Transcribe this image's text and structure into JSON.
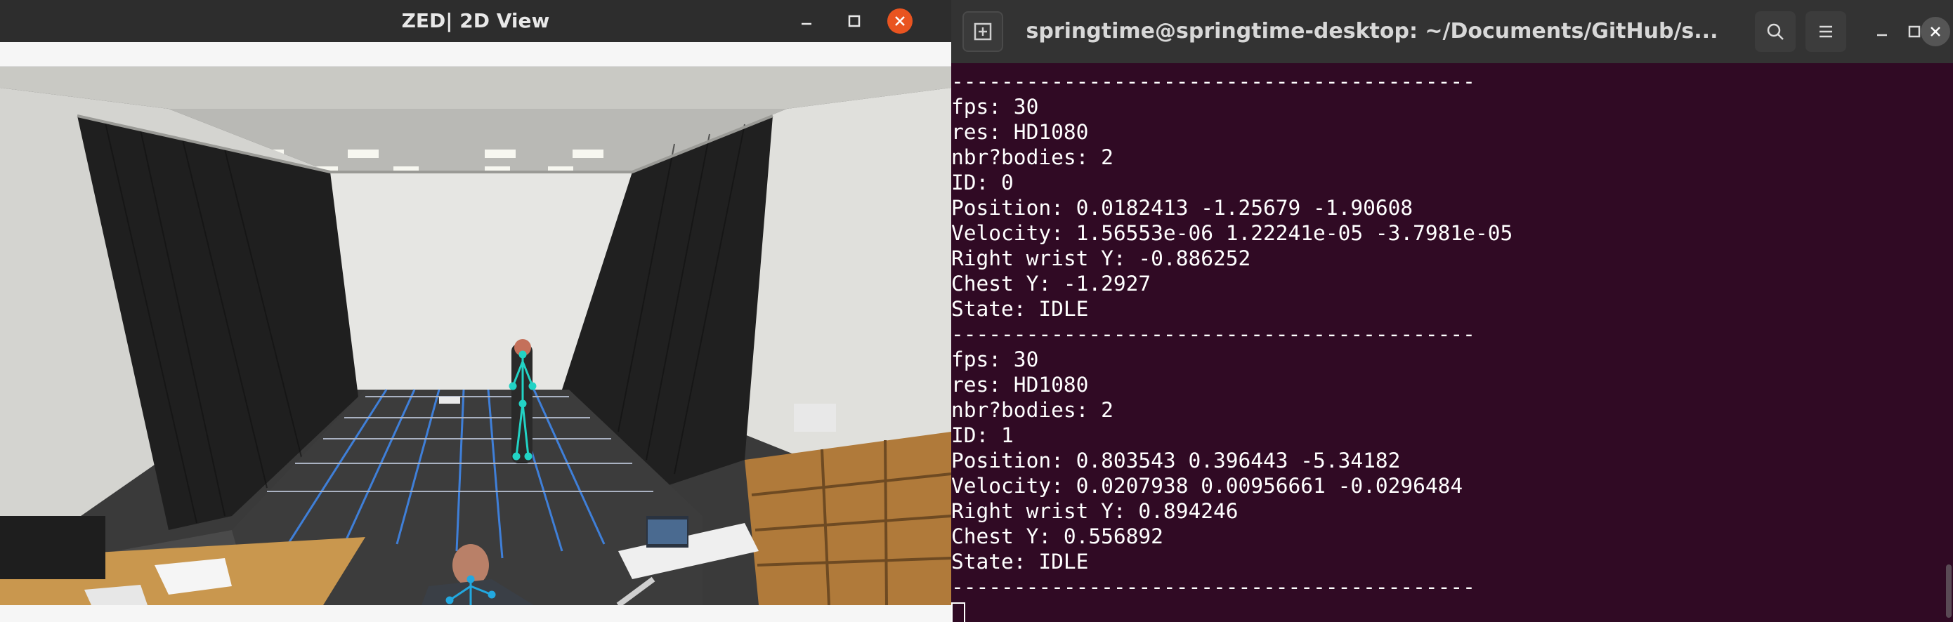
{
  "zed_window": {
    "title": "ZED| 2D View"
  },
  "terminal": {
    "title": "springtime@springtime-desktop: ~/Documents/GitHub/s...",
    "lines": [
      "------------------------------------------",
      "fps: 30",
      "res: HD1080",
      "nbr?bodies: 2",
      "ID: 0",
      "Position: 0.0182413 -1.25679 -1.90608",
      "Velocity: 1.56553e-06 1.22241e-05 -3.7981e-05",
      "Right wrist Y: -0.886252",
      "Chest Y: -1.2927",
      "State: IDLE",
      "------------------------------------------",
      "fps: 30",
      "res: HD1080",
      "nbr?bodies: 2",
      "ID: 1",
      "Position: 0.803543 0.396443 -5.34182",
      "Velocity: 0.0207938 0.00956661 -0.0296484",
      "Right wrist Y: 0.894246",
      "Chest Y: 0.556892",
      "State: IDLE",
      "------------------------------------------"
    ]
  },
  "icons": {
    "zed_minimize": "minimize-icon",
    "zed_maximize": "maximize-icon",
    "zed_close": "close-icon",
    "new_tab": "new-tab-icon",
    "search": "search-icon",
    "menu": "hamburger-menu-icon",
    "term_minimize": "minimize-icon",
    "term_maximize": "maximize-icon",
    "term_close": "close-icon"
  },
  "colors": {
    "terminal_bg": "#300a24",
    "skeleton": "#22d3c5",
    "close_accent": "#e95420",
    "grid_lines": "#3f7fd8"
  }
}
